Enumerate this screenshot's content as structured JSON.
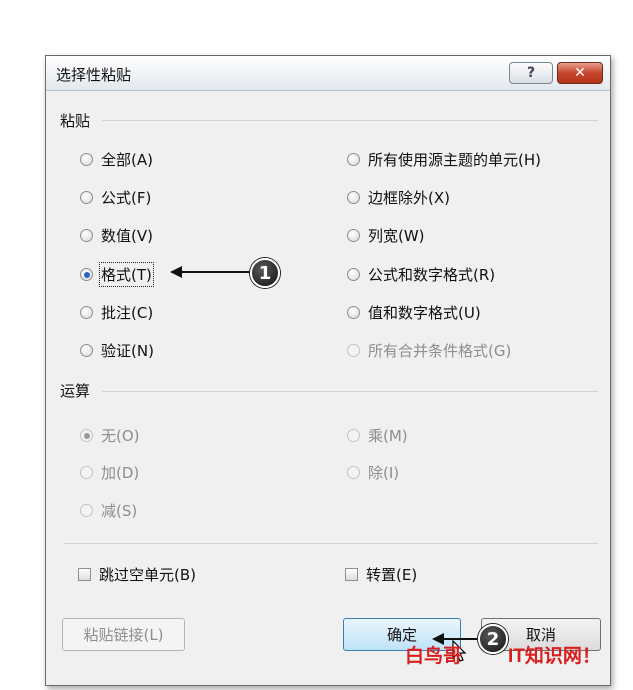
{
  "dialog": {
    "title": "选择性粘贴",
    "help_label": "?",
    "close_label": "✕"
  },
  "paste": {
    "label": "粘贴",
    "left_options": [
      {
        "text": "全部(A)",
        "selected": false,
        "enabled": true
      },
      {
        "text": "公式(F)",
        "selected": false,
        "enabled": true
      },
      {
        "text": "数值(V)",
        "selected": false,
        "enabled": true
      },
      {
        "text": "格式(T)",
        "selected": true,
        "enabled": true
      },
      {
        "text": "批注(C)",
        "selected": false,
        "enabled": true
      },
      {
        "text": "验证(N)",
        "selected": false,
        "enabled": true
      }
    ],
    "right_options": [
      {
        "text": "所有使用源主题的单元(H)",
        "selected": false,
        "enabled": true
      },
      {
        "text": "边框除外(X)",
        "selected": false,
        "enabled": true
      },
      {
        "text": "列宽(W)",
        "selected": false,
        "enabled": true
      },
      {
        "text": "公式和数字格式(R)",
        "selected": false,
        "enabled": true
      },
      {
        "text": "值和数字格式(U)",
        "selected": false,
        "enabled": true
      },
      {
        "text": "所有合并条件格式(G)",
        "selected": false,
        "enabled": false
      }
    ]
  },
  "operation": {
    "label": "运算",
    "options": [
      {
        "text": "无(O)",
        "selected": true,
        "enabled": false
      },
      {
        "text": "乘(M)",
        "selected": false,
        "enabled": false
      },
      {
        "text": "加(D)",
        "selected": false,
        "enabled": false
      },
      {
        "text": "除(I)",
        "selected": false,
        "enabled": false
      },
      {
        "text": "减(S)",
        "selected": false,
        "enabled": false
      }
    ]
  },
  "checkboxes": {
    "skip_blanks": "跳过空单元(B)",
    "transpose": "转置(E)"
  },
  "buttons": {
    "paste_link": "粘贴链接(L)",
    "ok": "确定",
    "cancel": "取消"
  },
  "callouts": {
    "one": "1",
    "two": "2"
  },
  "watermark": {
    "left": "白鸟哥",
    "right": "IT知识网！"
  },
  "colors": {
    "accent": "#2b63c4",
    "close_button": "#c4452c",
    "watermark": "#d81e1e"
  }
}
